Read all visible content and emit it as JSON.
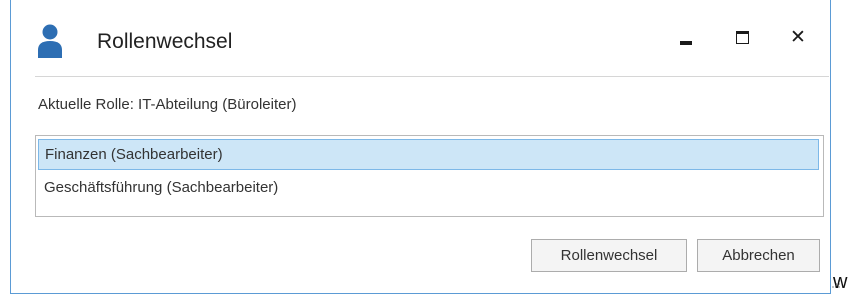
{
  "window": {
    "title": "Rollenwechsel",
    "icon": "user-icon",
    "controls": [
      "minimize-icon",
      "maximize-icon",
      "close-icon"
    ],
    "close_symbol": "✕",
    "border_color": "#5b9bd5"
  },
  "current_role": {
    "text": "Aktuelle Rolle: IT-Abteilung (Büroleiter)"
  },
  "role_list": {
    "items": [
      {
        "label": "Finanzen (Sachbearbeiter)",
        "selected": true
      },
      {
        "label": "Geschäftsführung (Sachbearbeiter)",
        "selected": false
      }
    ],
    "selection_color": "#cde6f7"
  },
  "buttons": {
    "switch_label": "Rollenwechsel",
    "cancel_label": "Abbrechen"
  },
  "outside": {
    "text": "w"
  }
}
